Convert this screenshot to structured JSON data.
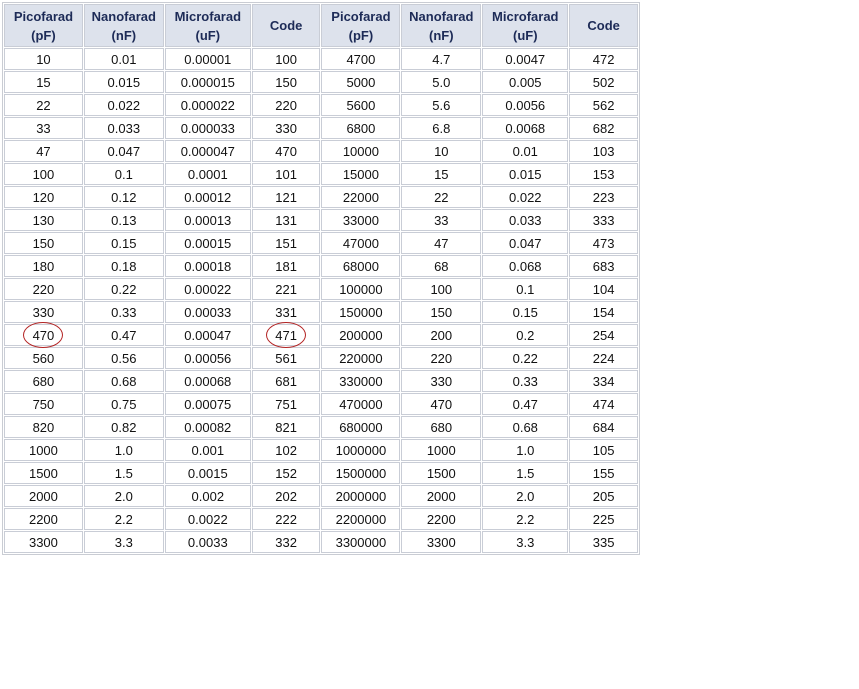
{
  "headers": [
    "Picofarad\n(pF)",
    "Nanofarad\n(nF)",
    "Microfarad\n(uF)",
    "Code",
    "Picofarad\n(pF)",
    "Nanofarad\n(nF)",
    "Microfarad\n(uF)",
    "Code"
  ],
  "header_lines": [
    [
      "Picofarad",
      "(pF)"
    ],
    [
      "Nanofarad",
      "(nF)"
    ],
    [
      "Microfarad",
      "(uF)"
    ],
    [
      "Code",
      ""
    ],
    [
      "Picofarad",
      "(pF)"
    ],
    [
      "Nanofarad",
      "(nF)"
    ],
    [
      "Microfarad",
      "(uF)"
    ],
    [
      "Code",
      ""
    ]
  ],
  "rows": [
    [
      "10",
      "0.01",
      "0.00001",
      "100",
      "4700",
      "4.7",
      "0.0047",
      "472"
    ],
    [
      "15",
      "0.015",
      "0.000015",
      "150",
      "5000",
      "5.0",
      "0.005",
      "502"
    ],
    [
      "22",
      "0.022",
      "0.000022",
      "220",
      "5600",
      "5.6",
      "0.0056",
      "562"
    ],
    [
      "33",
      "0.033",
      "0.000033",
      "330",
      "6800",
      "6.8",
      "0.0068",
      "682"
    ],
    [
      "47",
      "0.047",
      "0.000047",
      "470",
      "10000",
      "10",
      "0.01",
      "103"
    ],
    [
      "100",
      "0.1",
      "0.0001",
      "101",
      "15000",
      "15",
      "0.015",
      "153"
    ],
    [
      "120",
      "0.12",
      "0.00012",
      "121",
      "22000",
      "22",
      "0.022",
      "223"
    ],
    [
      "130",
      "0.13",
      "0.00013",
      "131",
      "33000",
      "33",
      "0.033",
      "333"
    ],
    [
      "150",
      "0.15",
      "0.00015",
      "151",
      "47000",
      "47",
      "0.047",
      "473"
    ],
    [
      "180",
      "0.18",
      "0.00018",
      "181",
      "68000",
      "68",
      "0.068",
      "683"
    ],
    [
      "220",
      "0.22",
      "0.00022",
      "221",
      "100000",
      "100",
      "0.1",
      "104"
    ],
    [
      "330",
      "0.33",
      "0.00033",
      "331",
      "150000",
      "150",
      "0.15",
      "154"
    ],
    [
      "470",
      "0.47",
      "0.00047",
      "471",
      "200000",
      "200",
      "0.2",
      "254"
    ],
    [
      "560",
      "0.56",
      "0.00056",
      "561",
      "220000",
      "220",
      "0.22",
      "224"
    ],
    [
      "680",
      "0.68",
      "0.00068",
      "681",
      "330000",
      "330",
      "0.33",
      "334"
    ],
    [
      "750",
      "0.75",
      "0.00075",
      "751",
      "470000",
      "470",
      "0.47",
      "474"
    ],
    [
      "820",
      "0.82",
      "0.00082",
      "821",
      "680000",
      "680",
      "0.68",
      "684"
    ],
    [
      "1000",
      "1.0",
      "0.001",
      "102",
      "1000000",
      "1000",
      "1.0",
      "105"
    ],
    [
      "1500",
      "1.5",
      "0.0015",
      "152",
      "1500000",
      "1500",
      "1.5",
      "155"
    ],
    [
      "2000",
      "2.0",
      "0.002",
      "202",
      "2000000",
      "2000",
      "2.0",
      "205"
    ],
    [
      "2200",
      "2.2",
      "0.0022",
      "222",
      "2200000",
      "2200",
      "2.2",
      "225"
    ],
    [
      "3300",
      "3.3",
      "0.0033",
      "332",
      "3300000",
      "3300",
      "3.3",
      "335"
    ]
  ],
  "highlighted_cells": [
    {
      "row": 12,
      "col": 0
    },
    {
      "row": 12,
      "col": 3
    }
  ],
  "colors": {
    "header_bg": "#dde2ec",
    "header_text": "#1d2b57",
    "border": "#c9cdd6",
    "highlight_circle": "#b32222"
  }
}
